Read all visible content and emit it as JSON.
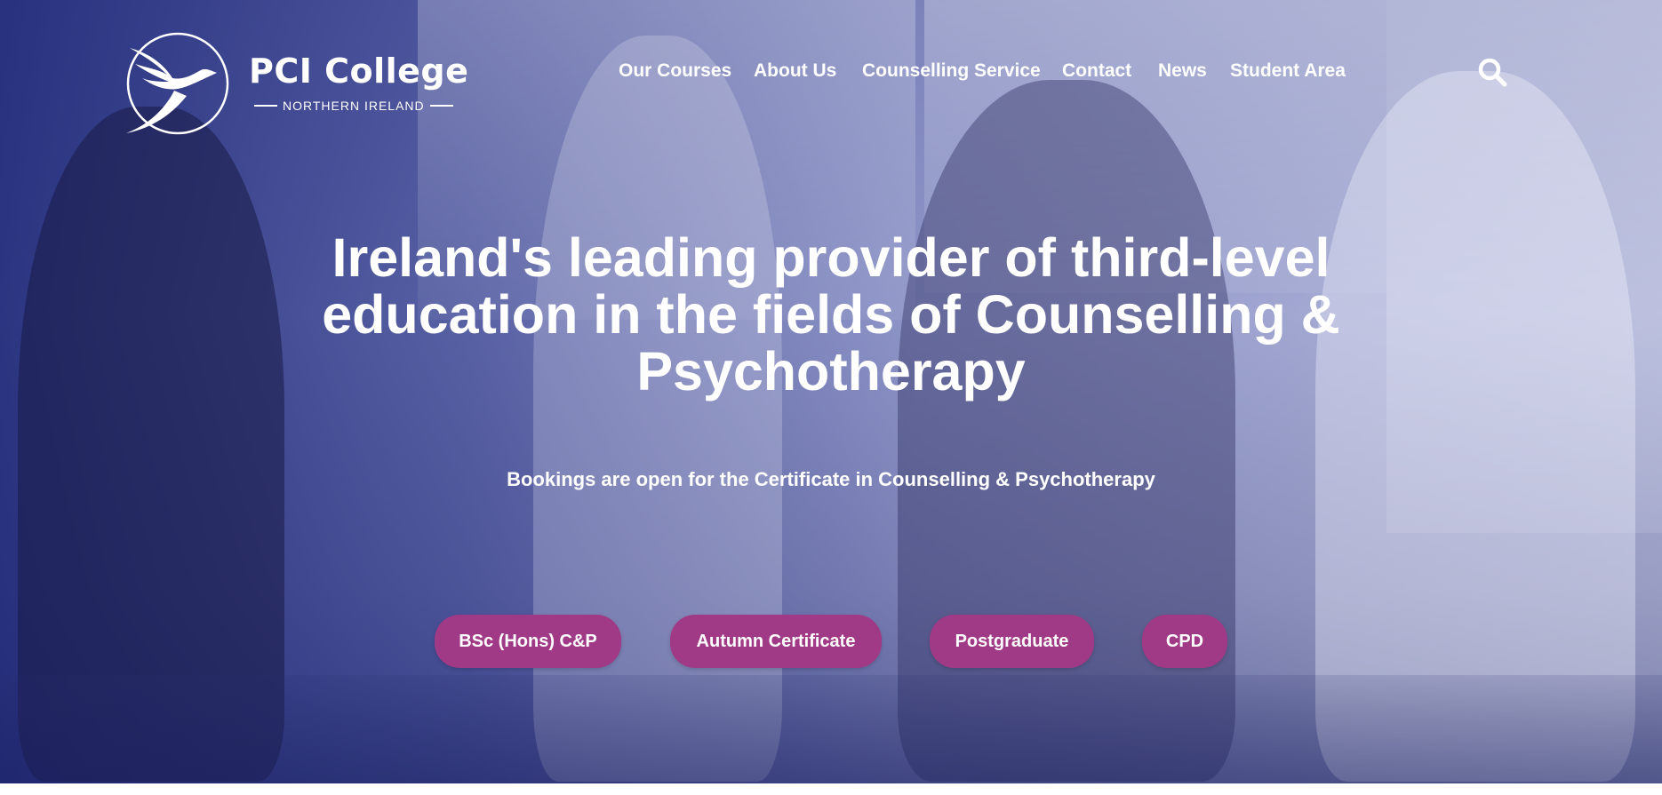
{
  "brand": {
    "name": "PCI College",
    "subtitle": "NORTHERN IRELAND",
    "logo_icon": "dove-icon"
  },
  "nav": {
    "items": [
      {
        "label": "Our Courses"
      },
      {
        "label": "About Us"
      },
      {
        "label": "Counselling Service"
      },
      {
        "label": "Contact"
      },
      {
        "label": "News"
      },
      {
        "label": "Student Area"
      }
    ],
    "search_icon": "search-icon"
  },
  "hero": {
    "headline": "Ireland's leading provider of third-level education in the fields of Counselling & Psychotherapy",
    "subline": "Bookings are open for the Certificate in Counselling & Psychotherapy",
    "buttons": [
      {
        "label": "BSc (Hons) C&P"
      },
      {
        "label": "Autumn Certificate"
      },
      {
        "label": "Postgraduate"
      },
      {
        "label": "CPD"
      }
    ]
  },
  "colors": {
    "overlay": "#1c2676",
    "button": "#a13a86",
    "text": "#ffffff"
  }
}
